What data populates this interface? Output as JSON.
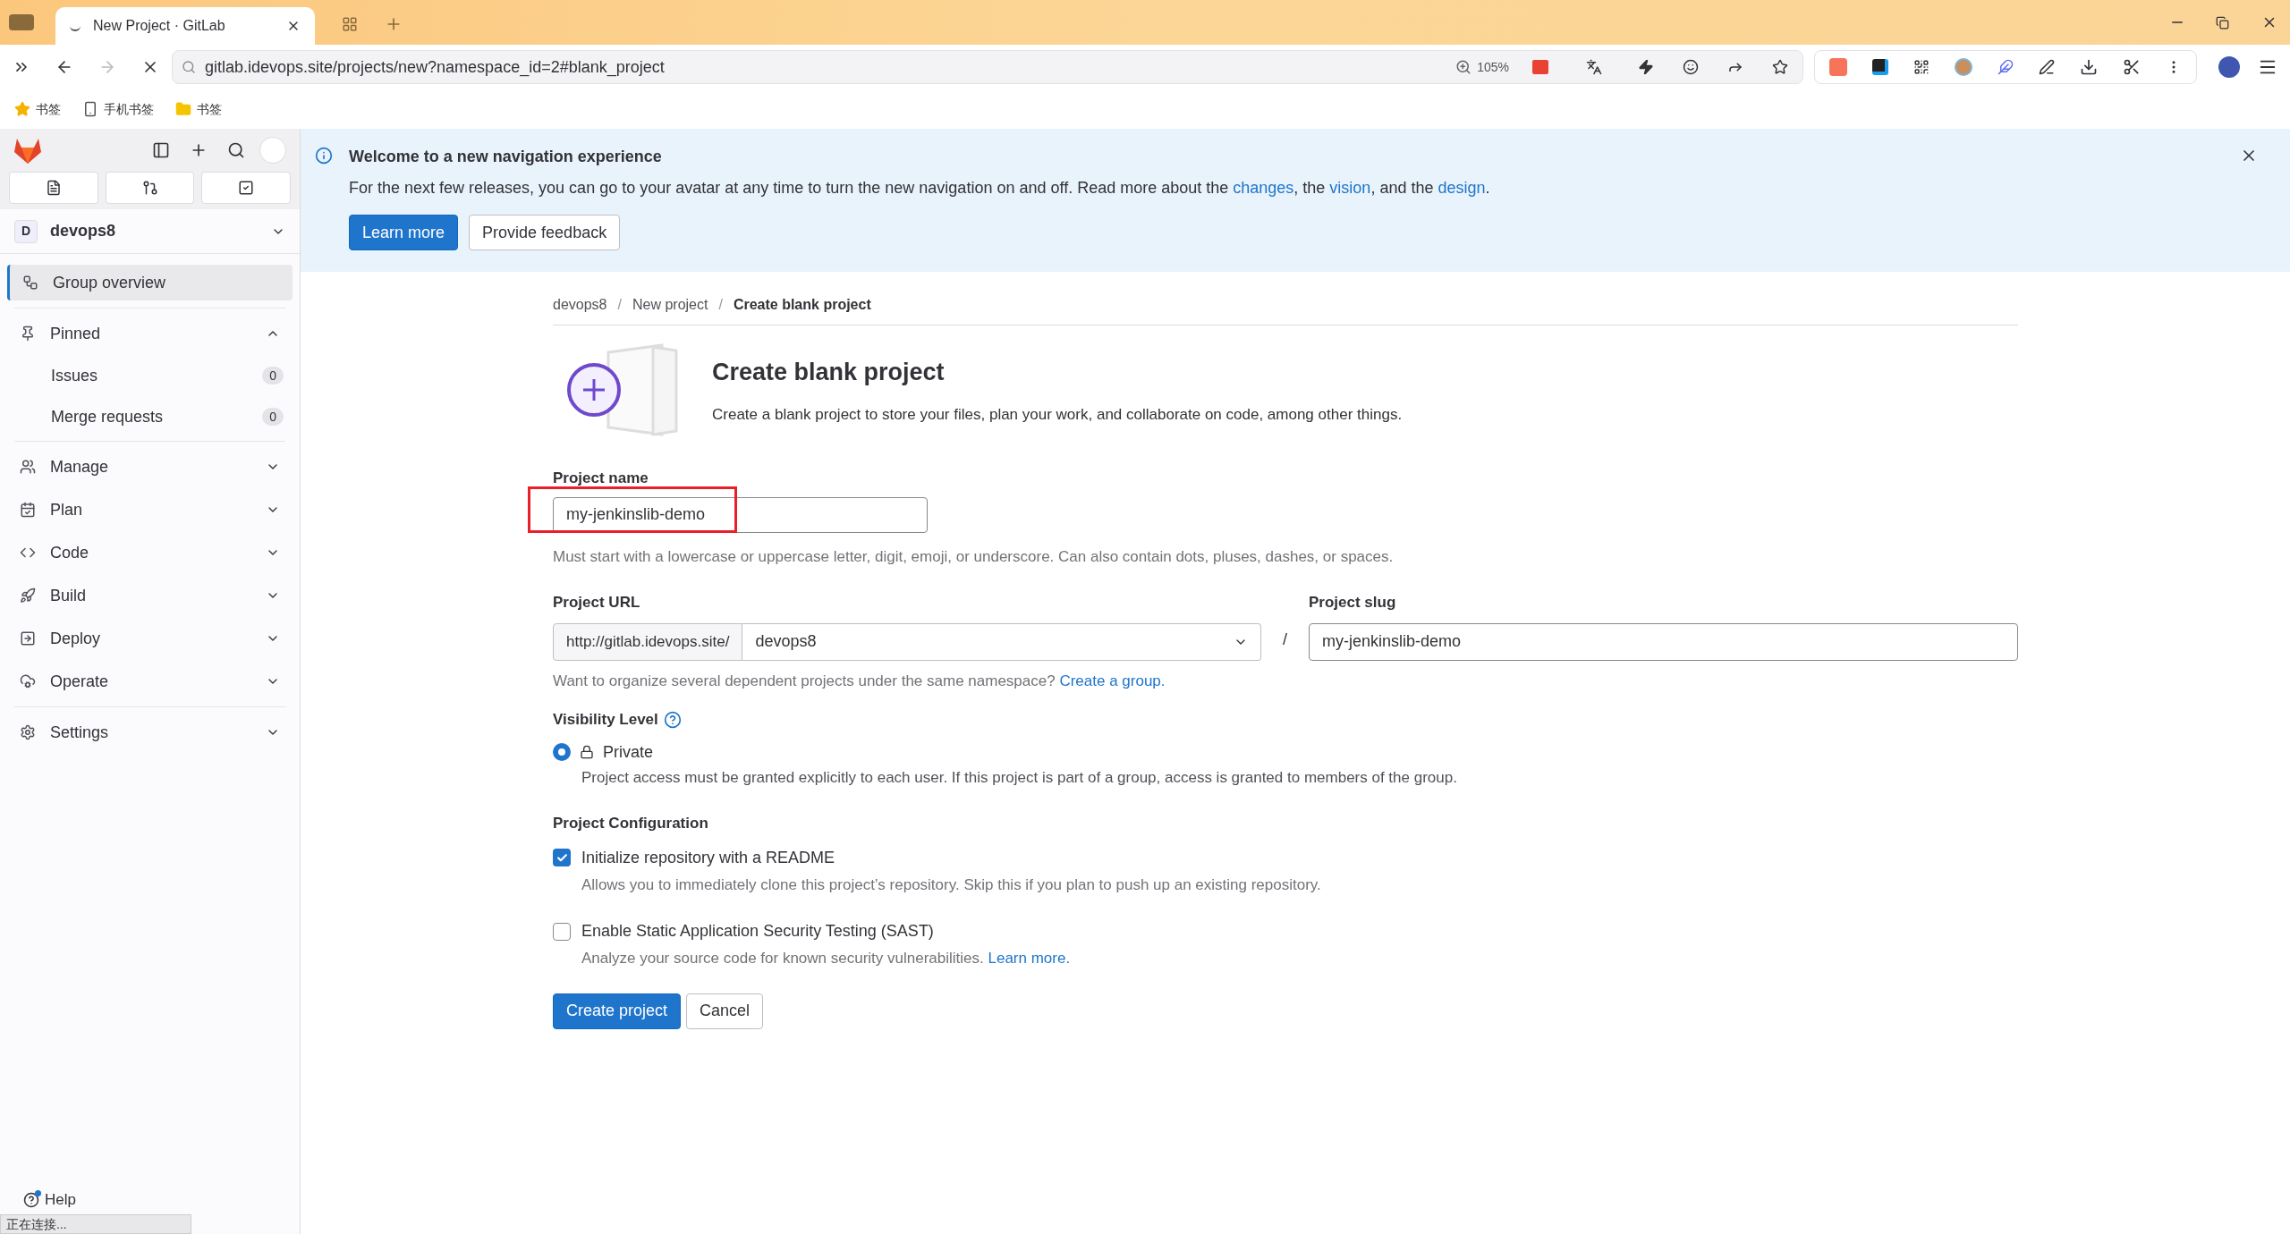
{
  "browser": {
    "tabs": [
      {
        "title": "New Project · GitLab",
        "selected": true
      }
    ],
    "url": "gitlab.idevops.site/projects/new?namespace_id=2#blank_project",
    "zoom": "105%",
    "bookmarks": [
      {
        "kind": "star",
        "label": "书签"
      },
      {
        "kind": "phone",
        "label": "手机书签"
      },
      {
        "kind": "folder",
        "label": "书签"
      }
    ]
  },
  "sidebar": {
    "group": {
      "initial": "D",
      "name": "devops8"
    },
    "items": [
      {
        "kind": "link",
        "label": "Group overview",
        "selected": true
      },
      {
        "kind": "section",
        "label": "Pinned",
        "expanded": true,
        "children": [
          {
            "label": "Issues",
            "count": "0"
          },
          {
            "label": "Merge requests",
            "count": "0"
          }
        ]
      },
      {
        "kind": "section",
        "label": "Manage",
        "expanded": false
      },
      {
        "kind": "section",
        "label": "Plan",
        "expanded": false
      },
      {
        "kind": "section",
        "label": "Code",
        "expanded": false
      },
      {
        "kind": "section",
        "label": "Build",
        "expanded": false
      },
      {
        "kind": "section",
        "label": "Deploy",
        "expanded": false
      },
      {
        "kind": "section",
        "label": "Operate",
        "expanded": false
      },
      {
        "kind": "section",
        "label": "Settings",
        "expanded": false
      }
    ],
    "help": "Help"
  },
  "banner": {
    "title": "Welcome to a new navigation experience",
    "text": [
      {
        "text": "For the next few releases, you can go to your avatar at any time to turn the new navigation on and off. Read more about the ",
        "link": false
      },
      {
        "text": "changes",
        "link": true
      },
      {
        "text": ", the ",
        "link": false
      },
      {
        "text": "vision",
        "link": true
      },
      {
        "text": ", and the ",
        "link": false
      },
      {
        "text": "design",
        "link": true
      },
      {
        "text": ".",
        "link": false
      }
    ],
    "buttons": [
      {
        "label": "Learn more",
        "kind": "primary"
      },
      {
        "label": "Provide feedback",
        "kind": "default"
      }
    ]
  },
  "breadcrumbs": [
    "devops8",
    "New project",
    "Create blank project"
  ],
  "breadcrumb_separator": "/",
  "heading": "Create blank project",
  "description": "Create a blank project to store your files, plan your work, and collaborate on code, among other things.",
  "project_name": {
    "label": "Project name",
    "value": "my-jenkinslib-demo",
    "highlighted": true,
    "help": "Must start with a lowercase or uppercase letter, digit, emoji, or underscore. Can also contain dots, pluses, dashes, or spaces."
  },
  "project_url": {
    "label": "Project URL",
    "prefix": "http://gitlab.idevops.site/",
    "namespace": "devops8",
    "separator": "/",
    "help": "Want to organize several dependent projects under the same namespace? ",
    "help_link": "Create a group."
  },
  "project_slug": {
    "label": "Project slug",
    "value": "my-jenkinslib-demo"
  },
  "visibility": {
    "label": "Visibility Level",
    "options": [
      {
        "label": "Private",
        "description": "Project access must be granted explicitly to each user. If this project is part of a group, access is granted to members of the group.",
        "selected": true
      }
    ]
  },
  "configuration": {
    "label": "Project Configuration",
    "options": [
      {
        "label": "Initialize repository with a README",
        "description": "Allows you to immediately clone this project’s repository. Skip this if you plan to push up an existing repository.",
        "checked": true
      },
      {
        "label": "Enable Static Application Security Testing (SAST)",
        "description": "Analyze your source code for known security vulnerabilities. ",
        "link": "Learn more.",
        "checked": false
      }
    ]
  },
  "actions": [
    {
      "label": "Create project",
      "kind": "primary"
    },
    {
      "label": "Cancel",
      "kind": "default"
    }
  ],
  "status_text": "正在连接..."
}
